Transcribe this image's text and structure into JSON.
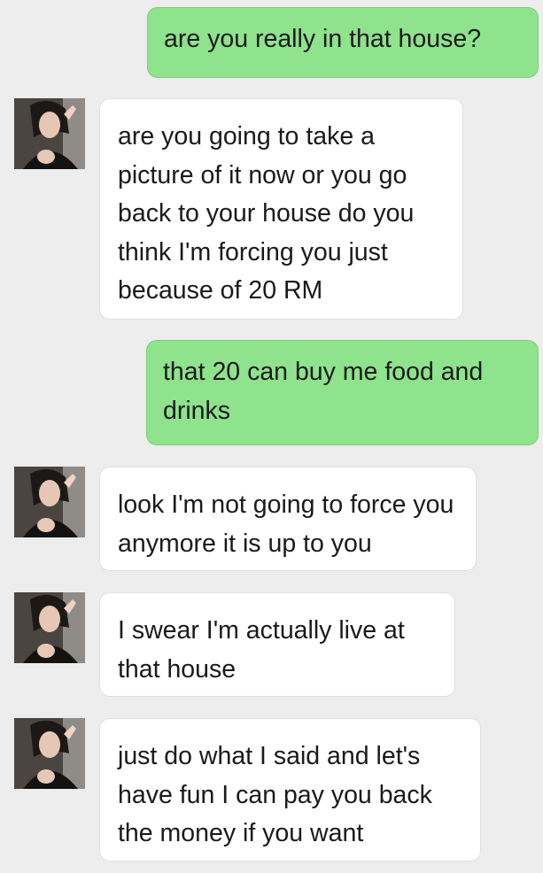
{
  "conversation": {
    "messages": [
      {
        "direction": "outgoing",
        "text": "are you really in that house?"
      },
      {
        "direction": "incoming",
        "text": "are you going to take a picture of it now or you go back to your house do you think I'm forcing you just because of 20 RM"
      },
      {
        "direction": "outgoing",
        "text": "that 20 can buy me food and drinks"
      },
      {
        "direction": "incoming",
        "text": "look I'm not going to force you anymore it is up to you"
      },
      {
        "direction": "incoming",
        "text": "I swear I'm actually live at that house"
      },
      {
        "direction": "incoming",
        "text": "just do what I said and let's have fun I can pay you back the money if you want"
      }
    ]
  },
  "colors": {
    "background": "#ededed",
    "outgoing_bubble": "#8ee38c",
    "incoming_bubble": "#ffffff",
    "text": "#1a1a1a"
  },
  "icons": {
    "contact_avatar": "contact-avatar-photo"
  }
}
